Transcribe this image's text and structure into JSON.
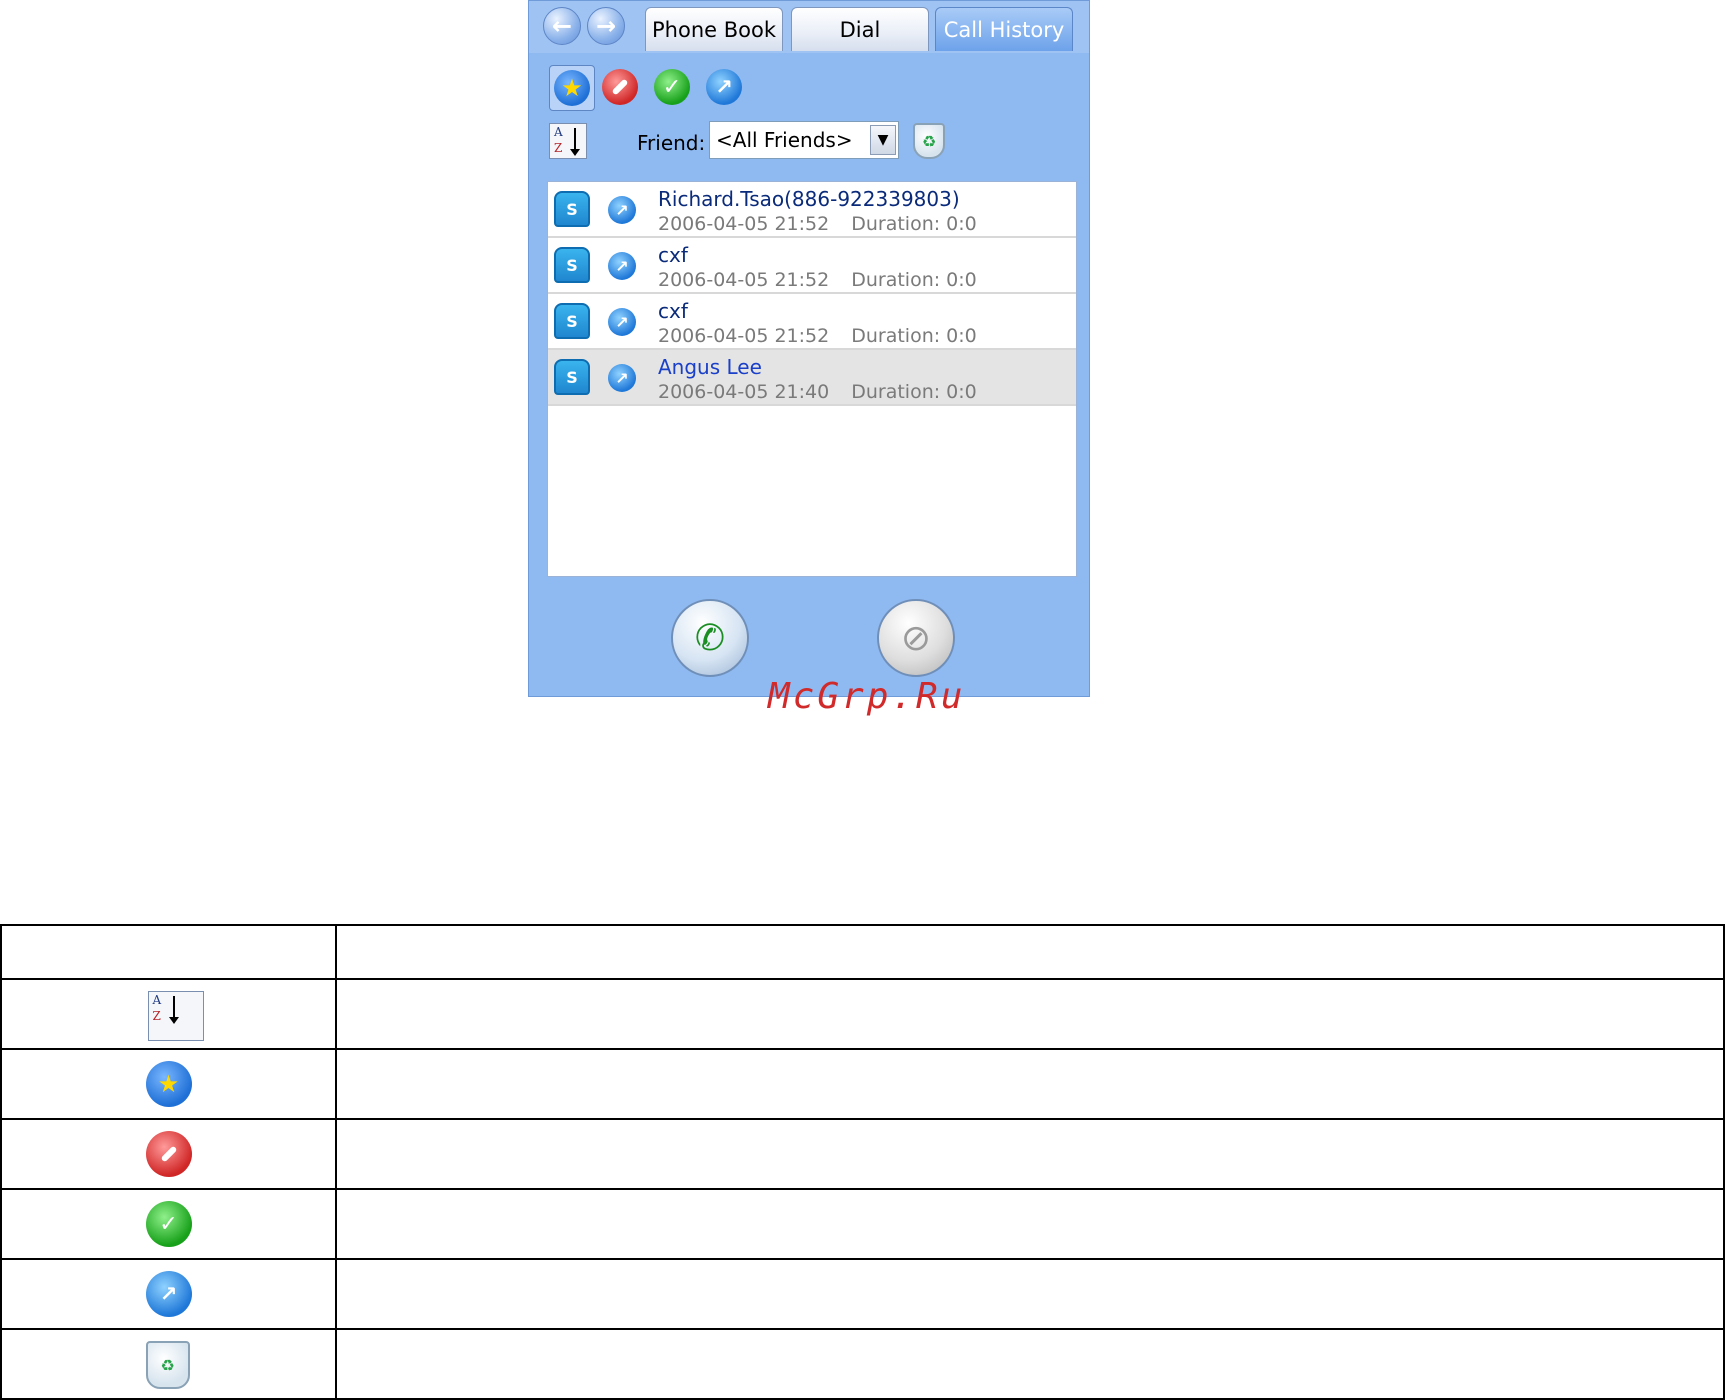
{
  "tabs": [
    {
      "label": "Phone Book",
      "active": false
    },
    {
      "label": "Dial",
      "active": false
    },
    {
      "label": "Call History",
      "active": true
    }
  ],
  "nav": {
    "back_icon": "back-arrow-icon",
    "forward_icon": "forward-arrow-icon"
  },
  "toolbar": {
    "filters": [
      "favorite-star-icon",
      "blocked-icon",
      "accepted-check-icon",
      "outgoing-arrow-icon"
    ],
    "sort_icon": "sort-az-icon",
    "delete_icon": "recycle-bin-icon"
  },
  "friend_filter": {
    "label": "Friend:",
    "value": "<All Friends>"
  },
  "call_history": [
    {
      "name": "Richard.Tsao(886-922339803)",
      "datetime": "2006-04-05 21:52",
      "duration": "Duration: 0:0",
      "selected": false
    },
    {
      "name": "cxf",
      "datetime": "2006-04-05 21:52",
      "duration": "Duration: 0:0",
      "selected": false
    },
    {
      "name": "cxf",
      "datetime": "2006-04-05 21:52",
      "duration": "Duration: 0:0",
      "selected": false
    },
    {
      "name": "Angus Lee",
      "datetime": "2006-04-05 21:40",
      "duration": "Duration: 0:0",
      "selected": true
    }
  ],
  "buttons": {
    "call_icon": "call-handset-icon",
    "hangup_icon": "hangup-handset-icon"
  },
  "watermark": "McGrp.Ru",
  "legend": {
    "rows": [
      {
        "icon": "sort-az-icon",
        "description": ""
      },
      {
        "icon": "favorite-star-icon",
        "description": ""
      },
      {
        "icon": "blocked-icon",
        "description": ""
      },
      {
        "icon": "accepted-check-icon",
        "description": ""
      },
      {
        "icon": "outgoing-arrow-icon",
        "description": ""
      },
      {
        "icon": "recycle-bin-icon",
        "description": ""
      }
    ]
  },
  "colors": {
    "window_bg": "#8fb9f1",
    "active_tab": "#6da2ea",
    "name_text": "#0a2a7a",
    "meta_text": "#7a7a7a",
    "watermark": "#d12a2a"
  }
}
